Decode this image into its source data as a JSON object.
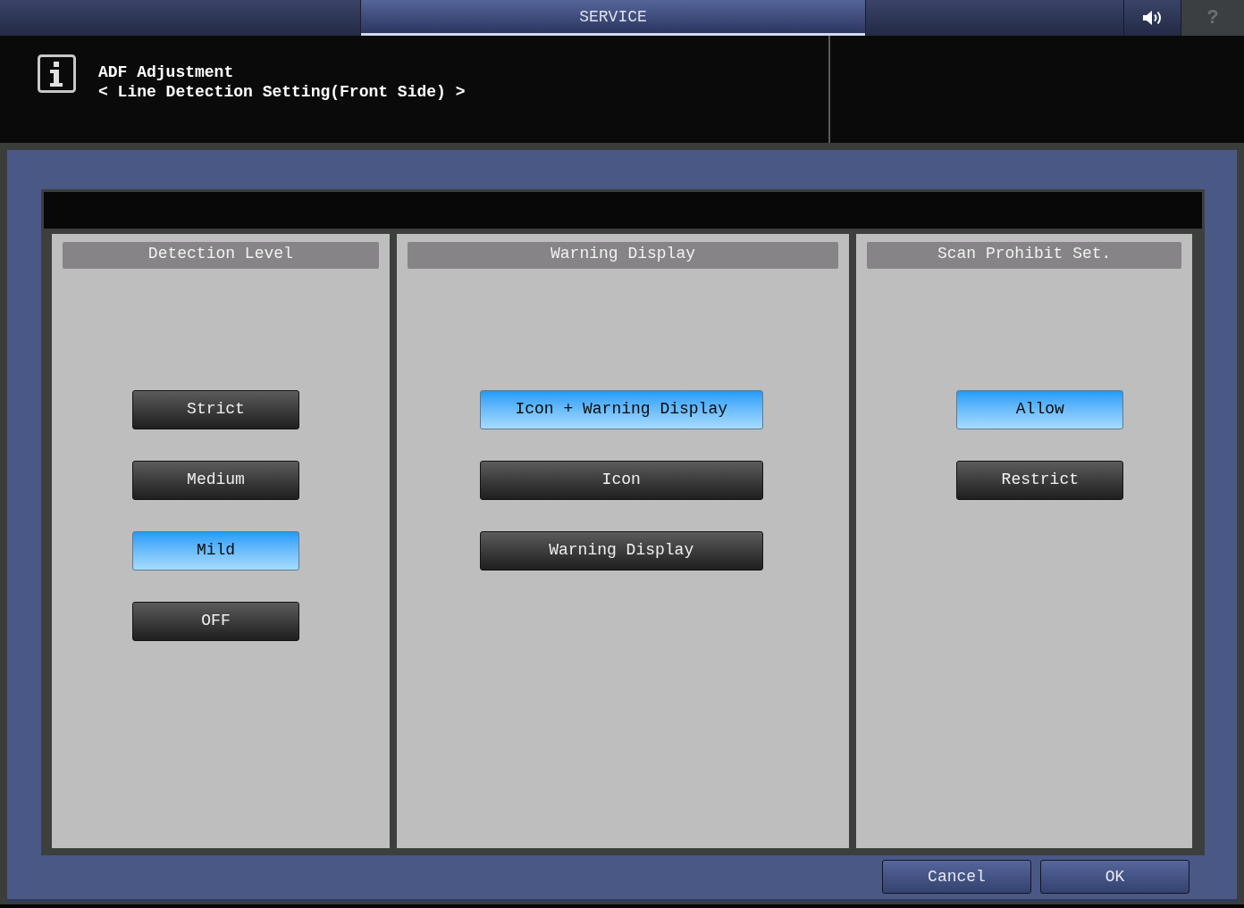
{
  "top_bar": {
    "tab": {
      "label": "SERVICE",
      "selected": true
    },
    "help_button": {
      "label": "?",
      "disabled": true
    }
  },
  "header": {
    "title": "ADF Adjustment",
    "subtitle": "< Line Detection Setting(Front Side) >"
  },
  "columns": [
    {
      "heading": "Detection Level",
      "options": [
        {
          "label": "Strict",
          "selected": false
        },
        {
          "label": "Medium",
          "selected": false
        },
        {
          "label": "Mild",
          "selected": true
        },
        {
          "label": "OFF",
          "selected": false
        }
      ]
    },
    {
      "heading": "Warning Display",
      "options": [
        {
          "label": "Icon + Warning Display",
          "selected": true
        },
        {
          "label": "Icon",
          "selected": false
        },
        {
          "label": "Warning Display",
          "selected": false
        }
      ]
    },
    {
      "heading": "Scan Prohibit Set.",
      "options": [
        {
          "label": "Allow",
          "selected": true
        },
        {
          "label": "Restrict",
          "selected": false
        }
      ]
    }
  ],
  "footer_buttons": [
    {
      "label": "Cancel"
    },
    {
      "label": "OK"
    }
  ]
}
